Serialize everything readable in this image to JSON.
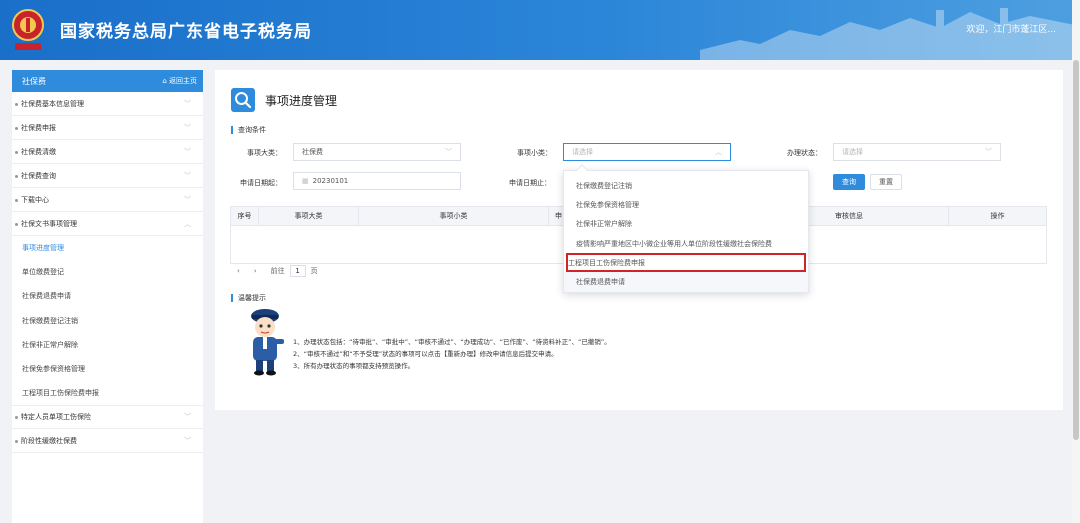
{
  "header": {
    "title": "国家税务总局广东省电子税务局",
    "welcome": "欢迎，江门市蓬江区..."
  },
  "sidebar": {
    "title": "社保费",
    "home_label": "返回主页",
    "items": [
      {
        "label": "社保费基本信息管理"
      },
      {
        "label": "社保费申报"
      },
      {
        "label": "社保费清缴"
      },
      {
        "label": "社保费查询"
      },
      {
        "label": "下载中心"
      },
      {
        "label": "社保文书事项管理"
      }
    ],
    "subitems": [
      {
        "label": "事项进度管理"
      },
      {
        "label": "单位缴费登记"
      },
      {
        "label": "社保费退费申请"
      },
      {
        "label": "社保缴费登记注销"
      },
      {
        "label": "社保非正常户解除"
      },
      {
        "label": "社保免参保资格管理"
      },
      {
        "label": "工程项目工伤保险费申报"
      }
    ],
    "items_after": [
      {
        "label": "特定人员单项工伤保险"
      },
      {
        "label": "阶段性缓缴社保费"
      }
    ]
  },
  "main": {
    "title": "事项进度管理",
    "query_section": "查询条件",
    "fields": {
      "category_label": "事项大类：",
      "category_value": "社保费",
      "subcategory_label": "事项小类：",
      "subcategory_placeholder": "请选择",
      "status_label": "办理状态：",
      "status_placeholder": "请选择",
      "date_start_label": "申请日期起：",
      "date_start_value": "20230101",
      "date_end_label": "申请日期止："
    },
    "query_button": "查询",
    "reset_button": "重置",
    "table": {
      "headers": [
        "序号",
        "事项大类",
        "事项小类",
        "申",
        "审核信息",
        "操作"
      ]
    },
    "pager": {
      "prev": "‹",
      "next": "›",
      "goto": "前往",
      "page": "1",
      "page_suffix": "页"
    },
    "tips_title": "温馨提示",
    "tips": [
      "1、办理状态包括：“待审批”、“审批中”、“审核不通过”、“办理成功”、“已作废”、“待资料补正”、“已撤销”。",
      "2、“审核不通过”和“不予受理”状态的事项可以点击【重新办理】修改申请信息后提交申请。",
      "3、所有办理状态的事项都支持预览操作。"
    ]
  },
  "dropdown": {
    "options": [
      {
        "label": "社保缴费登记注销"
      },
      {
        "label": "社保免参保资格管理"
      },
      {
        "label": "社保非正常户解除"
      },
      {
        "label": "疫情影响严重地区中小微企业等用人单位阶段性缓缴社会保险费"
      },
      {
        "label": "工程项目工伤保险费申报"
      },
      {
        "label": "社保费退费申请"
      }
    ],
    "highlighted_index": 4
  },
  "colors": {
    "primary": "#2f8bdc",
    "highlight": "#d0232a"
  }
}
